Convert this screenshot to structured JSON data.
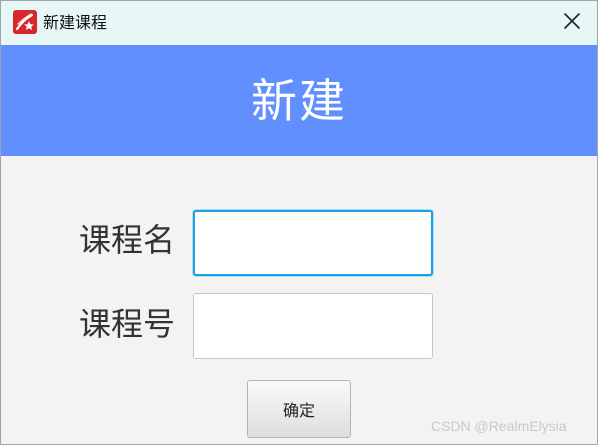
{
  "window": {
    "title": "新建课程",
    "app_icon": "superstar-logo-icon",
    "close_icon": "close-icon"
  },
  "banner": {
    "title": "新建"
  },
  "form": {
    "course_name_label": "课程名",
    "course_name_value": "",
    "course_code_label": "课程号",
    "course_code_value": "",
    "confirm_label": "确定"
  },
  "watermark": "CSDN @RealmElysia",
  "colors": {
    "titlebar_bg": "#e6f7f5",
    "banner_bg": "#628ffe",
    "body_bg": "#f3f3f3",
    "focus_border": "#1c9fe3",
    "logo_red": "#d8262c"
  }
}
